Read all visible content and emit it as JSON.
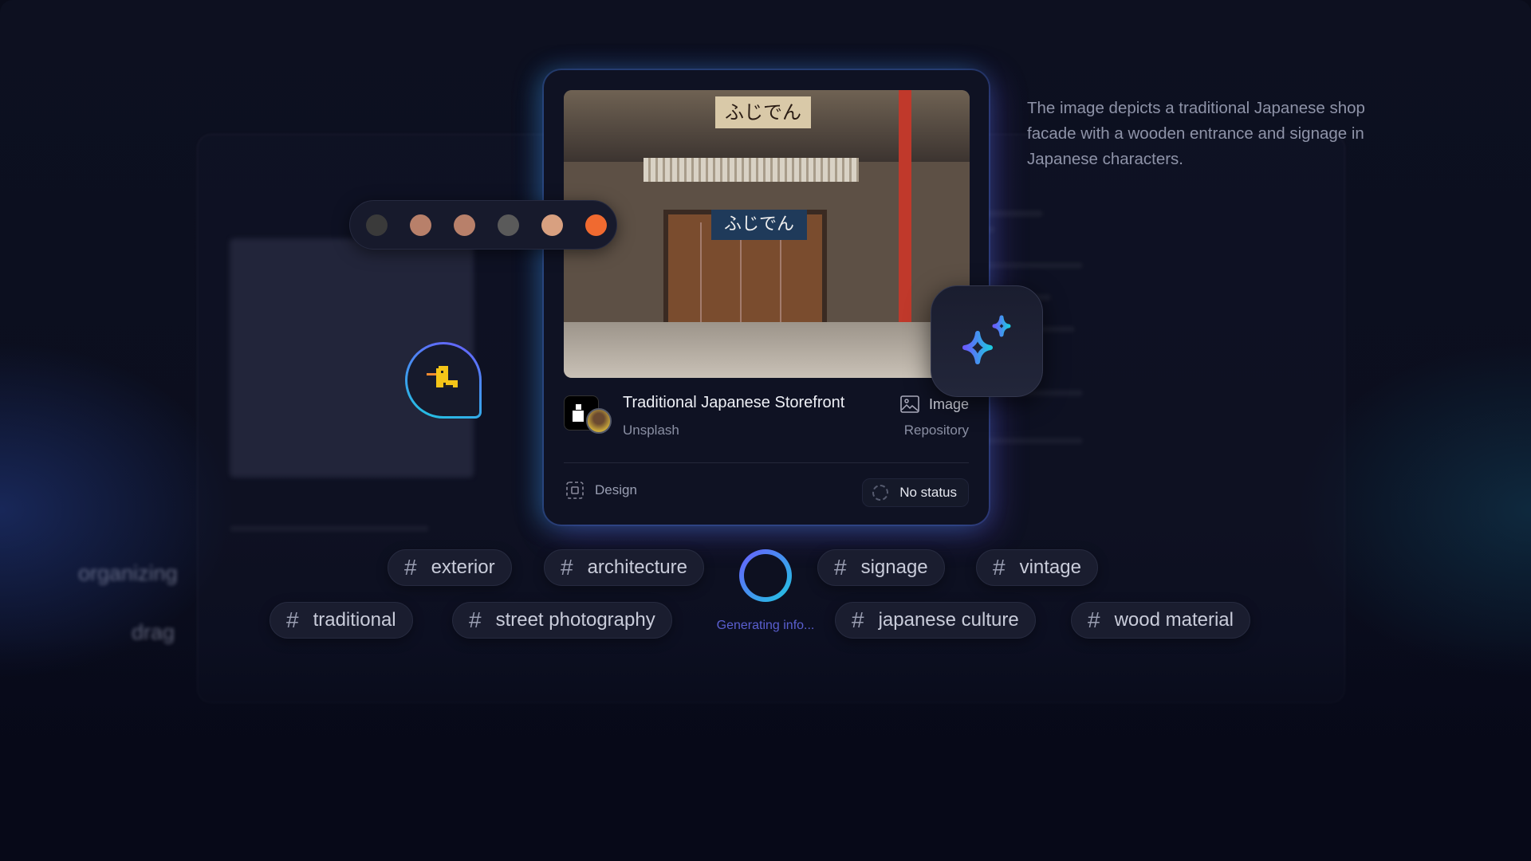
{
  "background": {
    "ghost_texts": [
      "organizing",
      "drag"
    ]
  },
  "card": {
    "photo": {
      "sign_top": "ふじでん",
      "sign_door": "ふじでん"
    },
    "title": "Traditional Japanese Storefront",
    "source": "Unsplash",
    "type_label": "Image",
    "type_icon": "image-icon",
    "collection": "Repository",
    "category": "Design",
    "category_icon": "dashed-frame-icon",
    "status": "No status"
  },
  "palette": {
    "colors": [
      "#3a3a3a",
      "#b8806a",
      "#b8806a",
      "#5a5a5a",
      "#d8a080",
      "#f06a30"
    ]
  },
  "description": "The image depicts a traditional Japanese shop facade with a wooden entrance and signage in Japanese characters.",
  "tags": {
    "row1": [
      "exterior",
      "architecture",
      "signage",
      "vintage"
    ],
    "row2": [
      "traditional",
      "street photography",
      "japanese culture",
      "wood material"
    ]
  },
  "generating": {
    "label": "Generating info..."
  },
  "colors": {
    "accent_start": "#6a5cff",
    "accent_end": "#1fc8e0",
    "background": "#0a0c1a"
  }
}
